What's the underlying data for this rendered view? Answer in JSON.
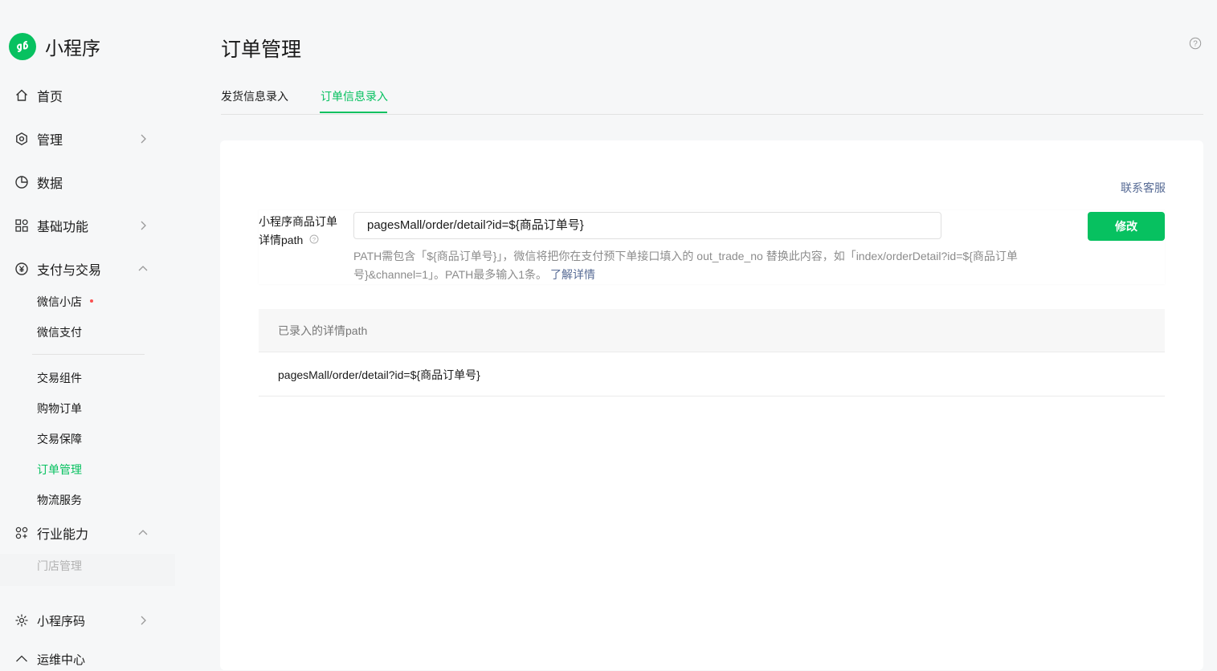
{
  "app": {
    "name": "小程序"
  },
  "sidebar": {
    "home": "首页",
    "manage": "管理",
    "data": "数据",
    "basic": "基础功能",
    "pay": "支付与交易",
    "pay_children": [
      "微信小店",
      "微信支付",
      "交易组件",
      "购物订单",
      "交易保障",
      "订单管理",
      "物流服务"
    ],
    "industry": "行业能力",
    "industry_children": [
      "门店管理"
    ],
    "qrcode": "小程序码",
    "next_partial": "运维中心"
  },
  "header": {
    "title": "订单管理",
    "tabs": [
      "发货信息录入",
      "订单信息录入"
    ],
    "active_tab": "订单信息录入"
  },
  "form": {
    "contact": "联系客服",
    "label": "小程序商品订单详情path",
    "label_line1": "小程序商品订单",
    "label_line2": "详情path",
    "value": "pagesMall/order/detail?id=${商品订单号}",
    "button": "修改",
    "hint_text": "PATH需包含「${商品订单号}」，微信将把你在支付预下单接口填入的 out_trade_no 替换此内容，如「index/orderDetail?id=${商品订单号}&channel=1」。PATH最多输入1条。",
    "hint_link": "了解详情"
  },
  "table": {
    "header": "已录入的详情path",
    "rows": [
      "pagesMall/order/detail?id=${商品订单号}"
    ]
  },
  "colors": {
    "brand": "#07c160",
    "link": "#576b95"
  }
}
